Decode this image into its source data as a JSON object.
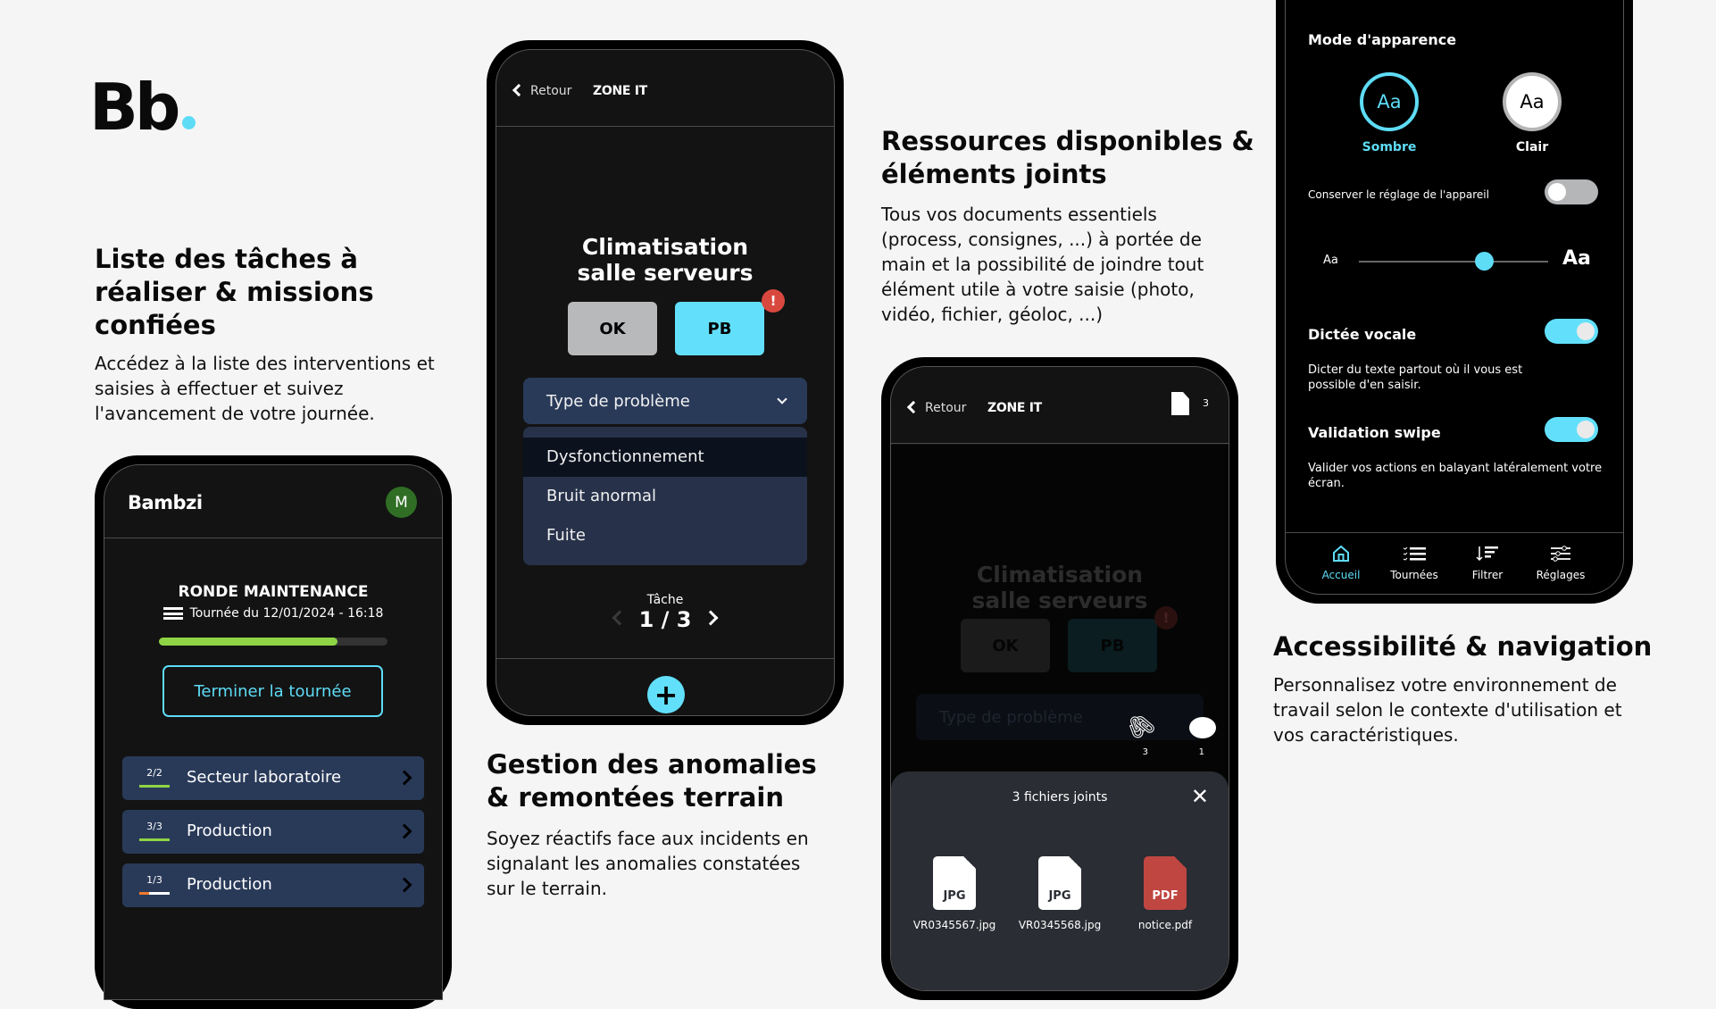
{
  "brand": {
    "logo_text": "Bb",
    "accent": "#5edcf6"
  },
  "sections": [
    {
      "title": "Liste des tâches à réaliser & missions confiées",
      "body": "Accédez à la liste des interventions et saisies à effectuer et suivez l'avancement de votre journée."
    },
    {
      "title": "Gestion des anomalies & remontées terrain",
      "body": "Soyez réactifs face aux incidents en signalant les anomalies constatées sur le terrain."
    },
    {
      "title": "Ressources disponibles & éléments joints",
      "body": "Tous vos documents essentiels (process, consignes, ...) à portée de main et la possibilité de joindre tout élément utile à votre saisie (photo, vidéo, fichier, géoloc, ...)"
    },
    {
      "title": "Accessibilité & navigation",
      "body": "Personnalisez votre environnement de travail selon le contexte d'utilisation et vos caractéristiques."
    }
  ],
  "phone_tasks": {
    "app_name": "Bambzi",
    "avatar_initial": "M",
    "round_title": "RONDE MAINTENANCE",
    "round_subtitle": "Tournée du 12/01/2024 - 16:18",
    "progress_fraction": 0.78,
    "finish_button": "Terminer la tournée",
    "sectors": [
      {
        "ratio": "2/2",
        "label": "Secteur laboratoire",
        "done": 2,
        "total": 2,
        "color": "#8ed445"
      },
      {
        "ratio": "3/3",
        "label": "Production",
        "done": 3,
        "total": 3,
        "color": "#8ed445"
      },
      {
        "ratio": "1/3",
        "label": "Production",
        "done": 1,
        "total": 3,
        "color": "#f07a2e"
      }
    ]
  },
  "phone_anomaly": {
    "back_label": "Retour",
    "zone": "ZONE IT",
    "task_title_line1": "Climatisation",
    "task_title_line2": "salle serveurs",
    "ok_label": "OK",
    "pb_label": "PB",
    "alert_badge": "!",
    "select_placeholder": "Type de problème",
    "options": [
      "Dysfonctionnement",
      "Bruit anormal",
      "Fuite"
    ],
    "pager_label": "Tâche",
    "pager_value": "1 / 3",
    "add_label": "+"
  },
  "phone_files": {
    "back_label": "Retour",
    "zone": "ZONE IT",
    "doc_count": "3",
    "task_title_line1": "Climatisation",
    "task_title_line2": "salle serveurs",
    "ok_label": "OK",
    "pb_label": "PB",
    "alert_badge": "!",
    "select_placeholder": "Type de problème",
    "attach_count": "3",
    "comment_count": "1",
    "sheet_title": "3 fichiers joints",
    "files": [
      {
        "ext": "JPG",
        "name": "VR0345567.jpg",
        "color": "#ffffff"
      },
      {
        "ext": "JPG",
        "name": "VR0345568.jpg",
        "color": "#ffffff"
      },
      {
        "ext": "PDF",
        "name": "notice.pdf",
        "color": "#c04641"
      }
    ]
  },
  "phone_settings": {
    "appearance_title": "Mode d'apparence",
    "theme_sample": "Aa",
    "dark_label": "Sombre",
    "light_label": "Clair",
    "keep_device_label": "Conserver le réglage de l'appareil",
    "keep_device_on": false,
    "font_small": "Aa",
    "font_large": "Aa",
    "font_size_fraction": 0.66,
    "dictation_title": "Dictée vocale",
    "dictation_on": true,
    "dictation_desc": "Dicter du texte partout où il vous est possible d'en saisir.",
    "swipe_title": "Validation swipe",
    "swipe_on": true,
    "swipe_desc": "Valider vos actions en balayant latéralement votre écran.",
    "nav": [
      {
        "label": "Accueil",
        "icon": "home-icon",
        "active": true
      },
      {
        "label": "Tournées",
        "icon": "checklist-icon",
        "active": false
      },
      {
        "label": "Filtrer",
        "icon": "sort-filter-icon",
        "active": false
      },
      {
        "label": "Réglages",
        "icon": "sliders-icon",
        "active": false
      }
    ]
  }
}
